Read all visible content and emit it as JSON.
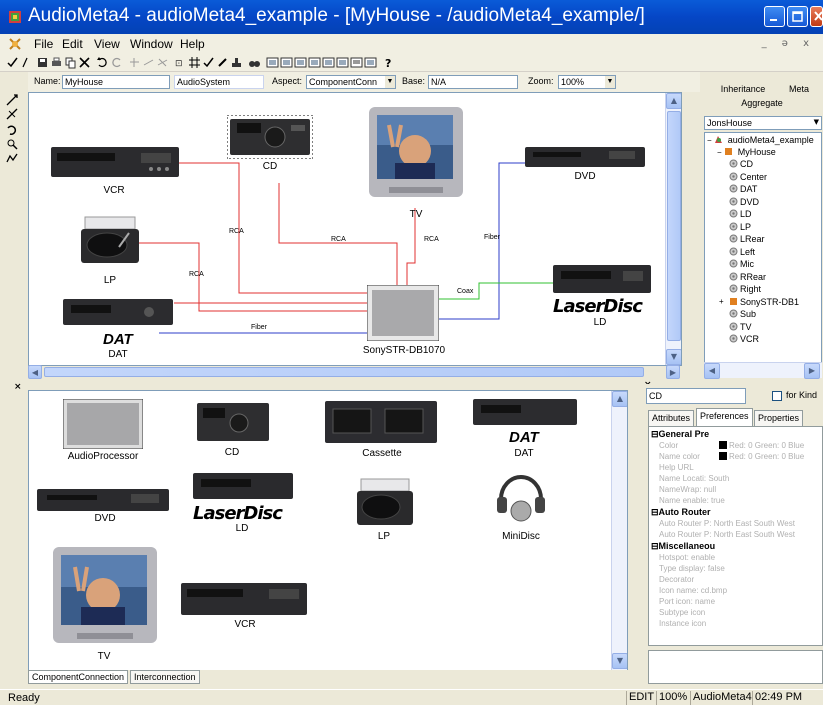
{
  "window": {
    "title": "AudioMeta4 - audioMeta4_example - [MyHouse - /audioMeta4_example/]",
    "buttons": [
      "minimize-icon",
      "maximize-icon",
      "close-icon"
    ],
    "accent": "#0546c6"
  },
  "menu": {
    "items": [
      "File",
      "Edit",
      "View",
      "Window",
      "Help"
    ],
    "mdi_controls": "_ ə x"
  },
  "propbar": {
    "name_label": "Name:",
    "name_value": "MyHouse",
    "kind_value": "AudioSystem",
    "aspect_label": "Aspect:",
    "aspect_value": "ComponentConn",
    "base_label": "Base:",
    "base_value": "N/A",
    "zoom_label": "Zoom:",
    "zoom_value": "100%"
  },
  "top_canvas": {
    "components": {
      "vcr": "VCR",
      "cd": "CD",
      "tv": "TV",
      "dvd": "DVD",
      "lp": "LP",
      "dat": "DAT",
      "dat_logo": "DAT",
      "ld": "LD",
      "ld_logo": "LaserDisc",
      "receiver": "SonySTR-DB1070"
    },
    "wire_labels": {
      "vcr": "RCA",
      "cd": "RCA",
      "tv": "RCA",
      "lp": "RCA",
      "dvd": "Fiber",
      "ld": "Coax",
      "dat": "Fiber"
    },
    "wire_colors": {
      "rca": "#e03030",
      "fiber": "#2c3cc8",
      "coax": "#30c030"
    }
  },
  "bottom_canvas": {
    "parts": {
      "audioprocessor": "AudioProcessor",
      "cd": "CD",
      "cassette": "Cassette",
      "dat": "DAT",
      "dat_logo": "DAT",
      "dvd": "DVD",
      "ld": "LD",
      "ld_logo": "LaserDisc",
      "lp": "LP",
      "minidisc": "MiniDisc",
      "tv": "TV",
      "vcr": "VCR"
    }
  },
  "doc_tabs": [
    "ComponentConnection",
    "Interconnection"
  ],
  "browser": {
    "tab_inheritance": "Inheritance",
    "tab_meta": "Meta",
    "tab_aggregate": "Aggregate",
    "filter_value": "JonsHouse",
    "root": "audioMeta4_example",
    "model": "MyHouse",
    "children": [
      "CD",
      "Center",
      "DAT",
      "DVD",
      "LD",
      "LP",
      "LRear",
      "Left",
      "Mic",
      "RRear",
      "Right",
      "SonySTR-DB1",
      "Sub",
      "TV",
      "VCR"
    ]
  },
  "properties": {
    "search_value": "CD",
    "for_kind_label": "for Kind",
    "tabs": [
      "Attributes",
      "Preferences",
      "Properties"
    ],
    "active_tab": "Preferences",
    "sections": [
      {
        "title": "General Pre",
        "rows": [
          "Color",
          "Name color",
          "Help URL",
          "Name Locati: South",
          "NameWrap: null",
          "Name enable: true"
        ]
      },
      {
        "title": "Auto Router",
        "rows": [
          "Auto Router P: North East South West",
          "Auto Router P: North East South West"
        ]
      },
      {
        "title": "Miscellaneou",
        "rows": [
          "Hotspot: enable",
          "Type display: false",
          "Decorator",
          "Icon name: cd.bmp",
          "Port icon: name",
          "Subtype icon",
          "Instance icon"
        ]
      }
    ],
    "color_values": "Red: 0 Green: 0 Blue",
    "name_color_values": "Red: 0 Green: 0 Blue"
  },
  "status": {
    "text": "Ready",
    "mode": "EDIT",
    "zoom": "100%",
    "app": "AudioMeta4",
    "time": "02:49 PM"
  }
}
